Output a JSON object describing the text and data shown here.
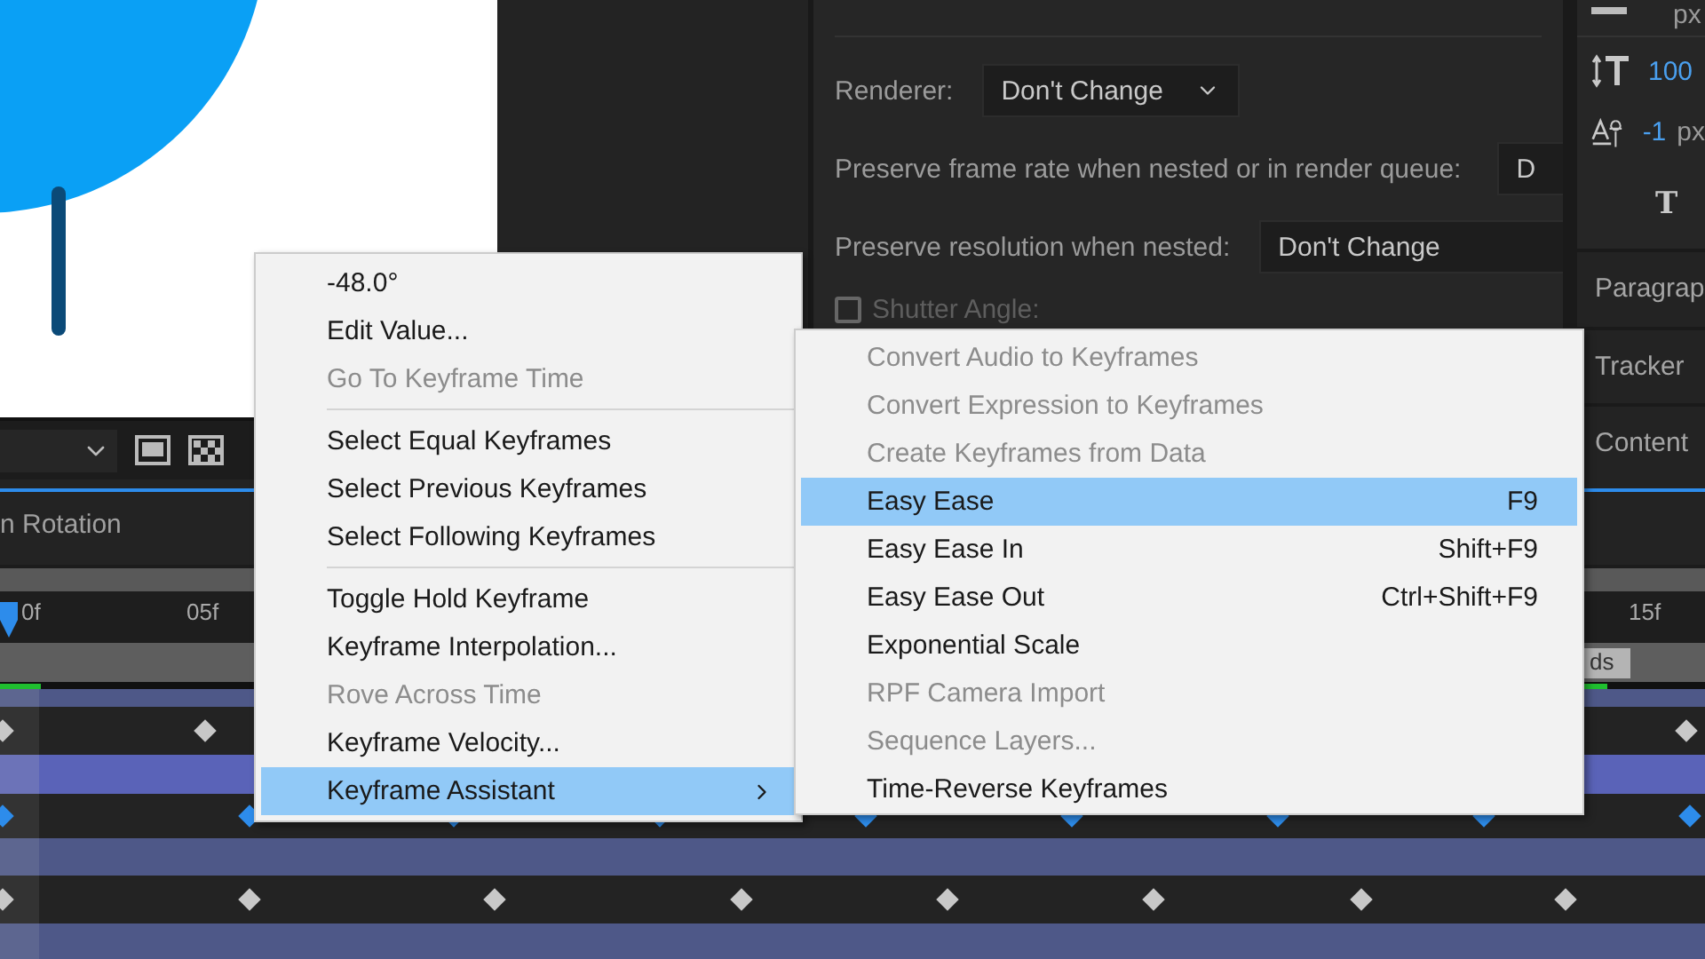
{
  "composition_settings": {
    "renderer": {
      "label": "Renderer:",
      "value": "Don't Change"
    },
    "frame_rate": {
      "label": "Preserve frame rate when nested or in render queue:",
      "value": "D"
    },
    "resolution": {
      "label": "Preserve resolution when nested:",
      "value": "Don't Change"
    },
    "shutter_angle": {
      "label": "Shutter Angle:",
      "checked": false,
      "disabled": true
    }
  },
  "character_panel": {
    "size_unit": "px",
    "leading": "100",
    "tracking": "-1",
    "tracking_unit": "px",
    "faux_bold": "T"
  },
  "panel_tabs": [
    "Paragrap",
    "Tracker",
    "Content"
  ],
  "timeline": {
    "layer_name": "n Rotation",
    "ruler": [
      "0f",
      "05f",
      "15f"
    ],
    "work_area_label": "ds"
  },
  "context_menu": {
    "items": [
      {
        "kind": "item",
        "label": "-48.0°",
        "disabled": false,
        "selected": false,
        "submenu": false
      },
      {
        "kind": "item",
        "label": "Edit Value...",
        "disabled": false,
        "selected": false,
        "submenu": false
      },
      {
        "kind": "item",
        "label": "Go To Keyframe Time",
        "disabled": true,
        "selected": false,
        "submenu": false
      },
      {
        "kind": "separator"
      },
      {
        "kind": "item",
        "label": "Select Equal Keyframes",
        "disabled": false,
        "selected": false,
        "submenu": false
      },
      {
        "kind": "item",
        "label": "Select Previous Keyframes",
        "disabled": false,
        "selected": false,
        "submenu": false
      },
      {
        "kind": "item",
        "label": "Select Following Keyframes",
        "disabled": false,
        "selected": false,
        "submenu": false
      },
      {
        "kind": "separator"
      },
      {
        "kind": "item",
        "label": "Toggle Hold Keyframe",
        "disabled": false,
        "selected": false,
        "submenu": false
      },
      {
        "kind": "item",
        "label": "Keyframe Interpolation...",
        "disabled": false,
        "selected": false,
        "submenu": false
      },
      {
        "kind": "item",
        "label": "Rove Across Time",
        "disabled": true,
        "selected": false,
        "submenu": false
      },
      {
        "kind": "item",
        "label": "Keyframe Velocity...",
        "disabled": false,
        "selected": false,
        "submenu": false
      },
      {
        "kind": "item",
        "label": "Keyframe Assistant",
        "disabled": false,
        "selected": true,
        "submenu": true
      }
    ]
  },
  "submenu": {
    "items": [
      {
        "label": "Convert Audio to Keyframes",
        "disabled": true,
        "selected": false
      },
      {
        "label": "Convert Expression to Keyframes",
        "disabled": true,
        "selected": false
      },
      {
        "label": "Create Keyframes from Data",
        "disabled": true,
        "selected": false
      },
      {
        "label": "Easy Ease",
        "shortcut": "F9",
        "disabled": false,
        "selected": true
      },
      {
        "label": "Easy Ease In",
        "shortcut": "Shift+F9",
        "disabled": false,
        "selected": false
      },
      {
        "label": "Easy Ease Out",
        "shortcut": "Ctrl+Shift+F9",
        "disabled": false,
        "selected": false
      },
      {
        "label": "Exponential Scale",
        "disabled": false,
        "selected": false
      },
      {
        "label": "RPF Camera Import",
        "disabled": true,
        "selected": false
      },
      {
        "label": "Sequence Layers...",
        "disabled": true,
        "selected": false
      },
      {
        "label": "Time-Reverse Keyframes",
        "disabled": false,
        "selected": false
      }
    ]
  }
}
